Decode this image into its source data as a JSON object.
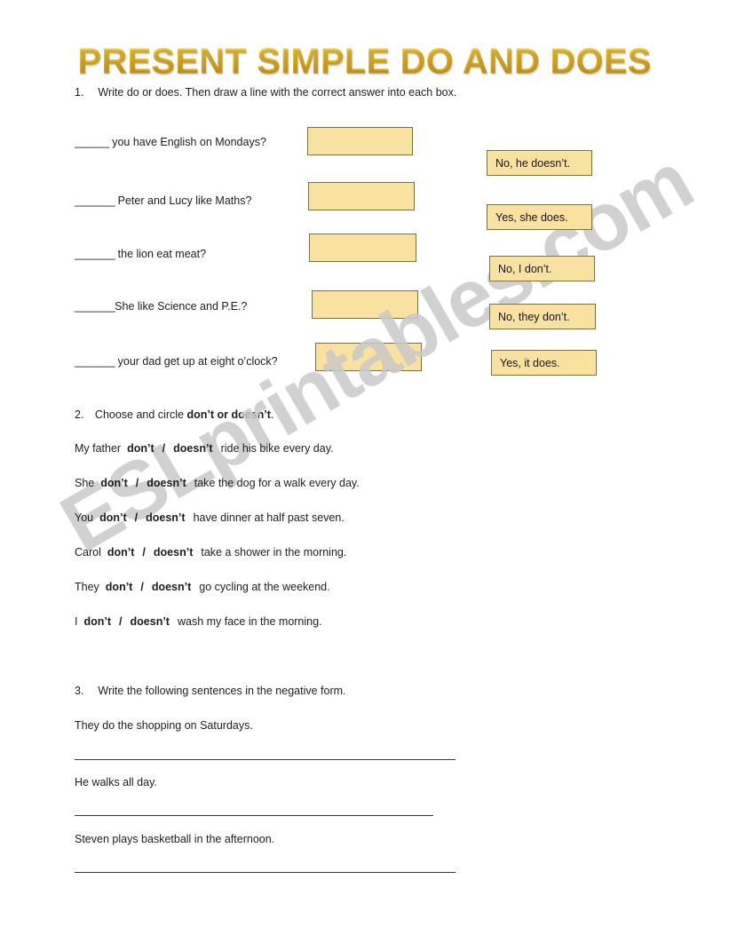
{
  "document": {
    "title": "PRESENT SIMPLE DO AND DOES",
    "watermark": "ESLprintables.com",
    "accent_color": "#e8b923",
    "box_fill_color": "#f9e1a0",
    "box_border_color": "#7c7140"
  },
  "exercise1": {
    "number": "1.",
    "instruction": "Write do or does. Then draw a line with the correct answer into each box.",
    "questions": [
      {
        "blank": "______",
        "text": " you have English on Mondays?"
      },
      {
        "blank": "_______",
        "text": " Peter and Lucy like Maths?"
      },
      {
        "blank": "_______",
        "text": " the lion eat meat?"
      },
      {
        "blank": "_______",
        "text": "She like Science and P.E.?"
      },
      {
        "blank": "_______",
        "text": " your dad get up at eight o’clock?"
      }
    ],
    "answers": [
      {
        "label": "No, he doesn’t."
      },
      {
        "label": "Yes, she does."
      },
      {
        "label": "No, I don’t."
      },
      {
        "label": "No, they don’t."
      },
      {
        "label": "Yes, it does."
      }
    ]
  },
  "exercise2": {
    "number": "2.",
    "instruction_plain": "Choose and circle ",
    "instruction_opt1": "don’t",
    "instruction_or": " or ",
    "instruction_opt2": "doesn’t",
    "instruction_end": ".",
    "option1": "don’t",
    "option2": "doesn’t",
    "separator": "/",
    "rows": [
      {
        "subject": "My father",
        "rest": "ride his bike every day."
      },
      {
        "subject": "She",
        "rest": "take the dog for a walk every day."
      },
      {
        "subject": "You",
        "rest": "have dinner at half past seven."
      },
      {
        "subject": "Carol",
        "rest": "take a shower in the morning."
      },
      {
        "subject": "They",
        "rest": "go cycling at the weekend."
      },
      {
        "subject": "I",
        "rest": "wash my face in the morning."
      }
    ]
  },
  "exercise3": {
    "number": "3.",
    "instruction": "Write the following sentences in the negative form.",
    "sentences": [
      "They do the shopping on Saturdays.",
      "He walks all day.",
      "Steven plays basketball in the afternoon."
    ]
  }
}
